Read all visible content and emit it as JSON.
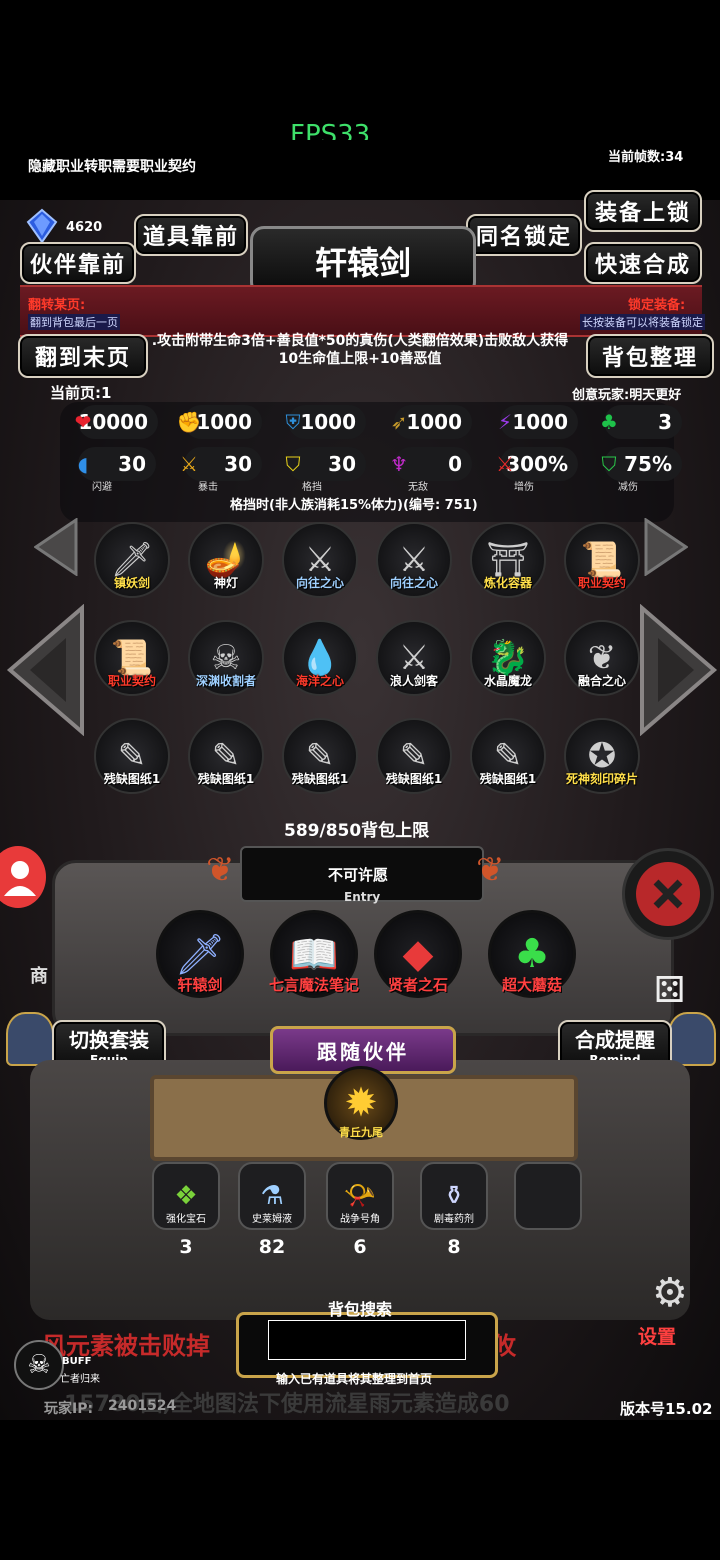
{
  "status": {
    "fps": "FPS33",
    "frame_rate_label": "当前帧数:34"
  },
  "notice": "隐藏职业转职需要职业契约",
  "currency": {
    "value": "4620"
  },
  "buttons": {
    "item_front": "道具靠前",
    "partner_front": "伙伴靠前",
    "same_name_lock": "同名锁定",
    "equip_lock": "装备上锁",
    "quick_synth": "快速合成",
    "goto_last": "翻到末页",
    "bag_sort": "背包整理",
    "switch_set": "切换套装",
    "switch_set_sub": "Equip",
    "synth_remind": "合成提醒",
    "synth_remind_sub": "Remind",
    "follow_partner": "跟随伙伴",
    "settings": "设置"
  },
  "item_title": "轩辕剑",
  "banner": {
    "left_title": "翻转某页:",
    "left_sub": "翻到背包最后一页",
    "right_title": "锁定装备:",
    "right_sub": "长按装备可以将装备锁定"
  },
  "description": ".攻击附带生命3倍+善良值*50的真伤(人类翻倍效果)击败敌人获得10生命值上限+10善恶值",
  "page_info": {
    "current": "当前页:1",
    "creator": "创意玩家:明天更好"
  },
  "stats_row1": [
    {
      "icon": "heart-icon",
      "glyph": "❤",
      "color": "#e8232f",
      "value": "10000"
    },
    {
      "icon": "strength-icon",
      "glyph": "✊",
      "color": "#e8c21a",
      "value": "1000"
    },
    {
      "icon": "armor-icon",
      "glyph": "⛨",
      "color": "#2f8fd8",
      "value": "1000"
    },
    {
      "icon": "bow-icon",
      "glyph": "➶",
      "color": "#c79a2a",
      "value": "1000"
    },
    {
      "icon": "lightning-icon",
      "glyph": "⚡",
      "color": "#9a3ae8",
      "value": "1000"
    },
    {
      "icon": "clover-icon",
      "glyph": "♣",
      "color": "#1ec24a",
      "value": "3"
    }
  ],
  "stats_row2": [
    {
      "icon": "dodge-icon",
      "glyph": "◖",
      "color": "#2f8fe8",
      "value": "30",
      "label": "闪避"
    },
    {
      "icon": "crit-icon",
      "glyph": "⚔",
      "color": "#e8a81a",
      "value": "30",
      "label": "暴击"
    },
    {
      "icon": "block-icon",
      "glyph": "⛉",
      "color": "#e8d21a",
      "value": "30",
      "label": "格挡"
    },
    {
      "icon": "invincible-icon",
      "glyph": "♆",
      "color": "#c02ac8",
      "value": "0",
      "label": "无敌"
    },
    {
      "icon": "damage-up-icon",
      "glyph": "⚔",
      "color": "#e82a2a",
      "value": "300%",
      "label": "增伤"
    },
    {
      "icon": "damage-down-icon",
      "glyph": "⛉",
      "color": "#2ac84a",
      "value": "75%",
      "label": "减伤"
    }
  ],
  "block_note": "格挡时(非人族消耗15%体力)(编号:  751)",
  "bag_items": [
    {
      "label": "镇妖剑",
      "glyph": "🗡",
      "color": "#ffdf4a"
    },
    {
      "label": "神灯",
      "glyph": "🪔",
      "color": "#ffffff"
    },
    {
      "label": "向往之心",
      "glyph": "⚔",
      "color": "#9fd0ff"
    },
    {
      "label": "向往之心",
      "glyph": "⚔",
      "color": "#9fd0ff"
    },
    {
      "label": "炼化容器",
      "glyph": "⛩",
      "color": "#ffdf4a"
    },
    {
      "label": "职业契约",
      "glyph": "📜",
      "color": "#ff3a2a"
    },
    {
      "label": "职业契约",
      "glyph": "📜",
      "color": "#ff3a2a"
    },
    {
      "label": "深渊收割者",
      "glyph": "☠",
      "color": "#9fd0ff"
    },
    {
      "label": "海洋之心",
      "glyph": "💧",
      "color": "#ff3a2a"
    },
    {
      "label": "浪人剑客",
      "glyph": "⚔",
      "color": "#ffffff"
    },
    {
      "label": "水晶魔龙",
      "glyph": "🐉",
      "color": "#ffffff"
    },
    {
      "label": "融合之心",
      "glyph": "❦",
      "color": "#ffffff"
    },
    {
      "label": "残缺图纸1",
      "glyph": "✎",
      "color": "#ffffff"
    },
    {
      "label": "残缺图纸1",
      "glyph": "✎",
      "color": "#ffffff"
    },
    {
      "label": "残缺图纸1",
      "glyph": "✎",
      "color": "#ffffff"
    },
    {
      "label": "残缺图纸1",
      "glyph": "✎",
      "color": "#ffffff"
    },
    {
      "label": "残缺图纸1",
      "glyph": "✎",
      "color": "#ffffff"
    },
    {
      "label": "死神刻印碎片",
      "glyph": "✪",
      "color": "#ffdf4a"
    }
  ],
  "bag_capacity": "589/850背包上限",
  "entry": {
    "title": "不可许愿",
    "sub": "Entry"
  },
  "equipped": [
    {
      "label": "轩辕剑",
      "glyph": "🗡"
    },
    {
      "label": "七言魔法笔记",
      "glyph": "📖"
    },
    {
      "label": "贤者之石",
      "glyph": "◆"
    },
    {
      "label": "超大蘑菇",
      "glyph": "♣"
    }
  ],
  "partner": {
    "label": "青丘九尾",
    "glyph": "✹"
  },
  "consumables": [
    {
      "label": "强化宝石",
      "glyph": "❖",
      "count": "3"
    },
    {
      "label": "史莱姆液",
      "glyph": "⚗",
      "count": "82"
    },
    {
      "label": "战争号角",
      "glyph": "📯",
      "count": "6"
    },
    {
      "label": "剧毒药剂",
      "glyph": "⚱",
      "count": "8"
    }
  ],
  "search": {
    "title": "背包搜索",
    "hint": "输入已有道具将其整理到首页",
    "value": ""
  },
  "background_text": {
    "line1": "风元素被击败掉",
    "line1_suffix": "攸",
    "line2": "15780回,全地图法下使用流星雨元素造成60"
  },
  "shop_label": "商",
  "buff": {
    "label": "BUFF",
    "sub": "亡者归来"
  },
  "player_ip": {
    "label": "玩家IP:",
    "value": "2401524"
  },
  "version": "版本号15.02",
  "colors": {
    "accent_gold": "#d8b040",
    "banner_red": "#6b1a22",
    "fps_green": "#3ee06a"
  }
}
